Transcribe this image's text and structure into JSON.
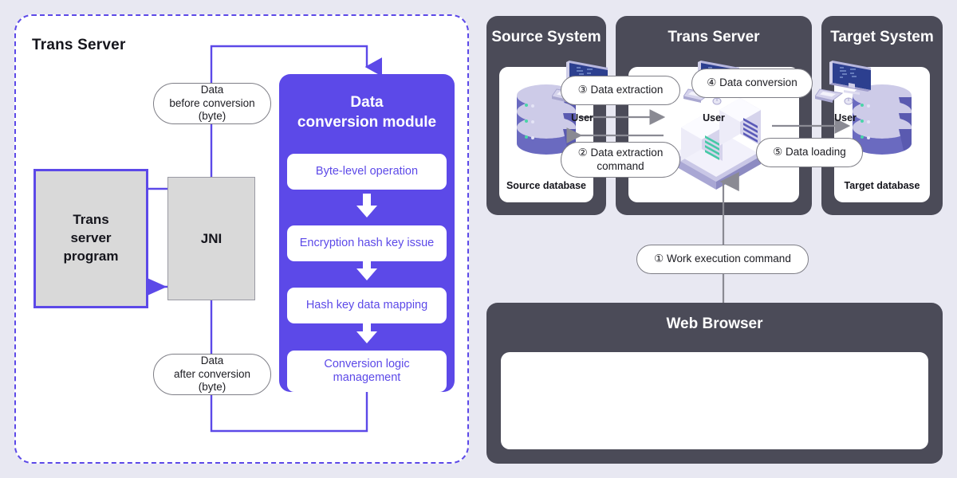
{
  "colors": {
    "background": "#e8e8f2",
    "accent_purple": "#5c49e8",
    "panel_dark": "#4b4b58",
    "box_gray": "#d9d9d9",
    "arrow_gray": "#8a8a93",
    "db_body": "#6a6ac0",
    "db_top": "#cdcbe8"
  },
  "left_panel": {
    "title": "Trans Server",
    "pill_before": "Data\nbefore conversion\n(byte)",
    "pill_after": "Data\nafter conversion\n(byte)",
    "trans_server_program": "Trans\nserver\nprogram",
    "jni": "JNI",
    "module": {
      "title": "Data\nconversion module",
      "steps": [
        "Byte-level operation",
        "Encryption hash key issue",
        "Hash key data mapping",
        "Conversion logic\nmanagement"
      ]
    }
  },
  "right_panels": [
    {
      "title": "Source System",
      "caption": "Source database",
      "icon": "database-icon"
    },
    {
      "title": "Trans Server",
      "caption": "",
      "icon": "server-rack-icon"
    },
    {
      "title": "Target System",
      "caption": "Target database",
      "icon": "database-icon"
    }
  ],
  "callouts": {
    "step1": "① Work execution command",
    "step2": "② Data extraction\ncommand",
    "step3": "③ Data extraction",
    "step4": "④ Data conversion",
    "step5": "⑤ Data loading"
  },
  "browser": {
    "title": "Web Browser",
    "users": [
      {
        "label": "User",
        "icon": "desktop-computer-icon"
      },
      {
        "label": "User",
        "icon": "desktop-computer-icon"
      },
      {
        "label": "User",
        "icon": "desktop-computer-icon"
      }
    ]
  },
  "chart_data": {
    "type": "diagram",
    "title": "Trans Server data conversion and ETL flow",
    "flow_sequence": [
      {
        "n": 1,
        "label": "Work execution command",
        "from": "Web Browser",
        "to": "Trans Server"
      },
      {
        "n": 2,
        "label": "Data extraction command",
        "from": "Trans Server",
        "to": "Source database"
      },
      {
        "n": 3,
        "label": "Data extraction",
        "from": "Source database",
        "to": "Trans Server"
      },
      {
        "n": 4,
        "label": "Data conversion",
        "from": "Trans Server",
        "to": "Trans Server"
      },
      {
        "n": 5,
        "label": "Data loading",
        "from": "Trans Server",
        "to": "Target database"
      }
    ],
    "module_pipeline": [
      "Byte-level operation",
      "Encryption hash key issue",
      "Hash key data mapping",
      "Conversion logic management"
    ]
  }
}
